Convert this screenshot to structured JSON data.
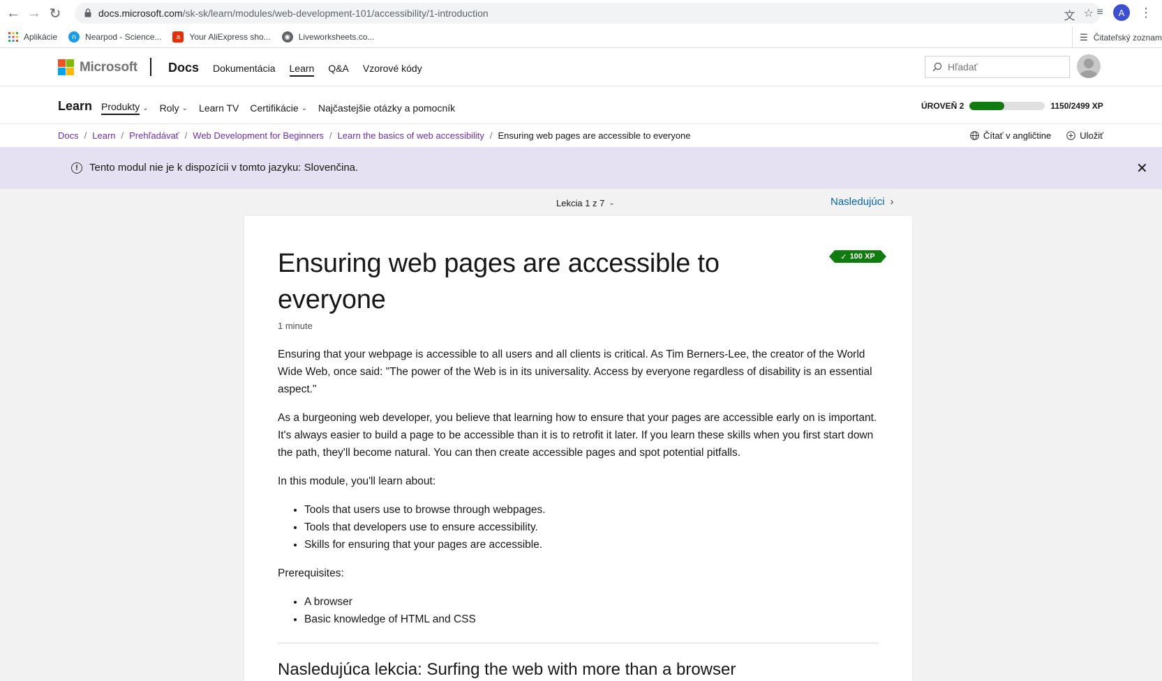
{
  "browser": {
    "url_host": "docs.microsoft.com",
    "url_path": "/sk-sk/learn/modules/web-development-101/accessibility/1-introduction",
    "profile_initial": "A",
    "bookmarks": [
      {
        "label": "Aplikácie",
        "icon": "apps-grid-icon"
      },
      {
        "label": "Nearpod - Science...",
        "icon": "nearpod-icon"
      },
      {
        "label": "Your AliExpress sho...",
        "icon": "aliexpress-icon"
      },
      {
        "label": "Liveworksheets.co...",
        "icon": "globe-icon"
      }
    ],
    "reading_list": "Čitateľský zoznam"
  },
  "header": {
    "brand": "Microsoft",
    "product": "Docs",
    "nav": [
      "Dokumentácia",
      "Learn",
      "Q&A",
      "Vzorové kódy"
    ],
    "search_placeholder": "Hľadať"
  },
  "learn_bar": {
    "title": "Learn",
    "nav": [
      "Produkty",
      "Roly",
      "Learn TV",
      "Certifikácie",
      "Najčastejšie otázky a pomocník"
    ],
    "level_label": "ÚROVEŇ 2",
    "xp_text": "1150/2499 XP",
    "xp_fraction": 0.46
  },
  "breadcrumb": {
    "items": [
      "Docs",
      "Learn",
      "Prehľadávať",
      "Web Development for Beginners",
      "Learn the basics of web accessibility"
    ],
    "current": "Ensuring web pages are accessible to everyone",
    "read_english": "Čítať v angličtine",
    "save": "Uložiť"
  },
  "alert": {
    "text": "Tento modul nie je k dispozícii v tomto jazyku: Slovenčina."
  },
  "lesson": {
    "position": "Lekcia 1 z 7",
    "next": "Nasledujúci",
    "xp_badge": "100 XP",
    "title": "Ensuring web pages are accessible to everyone",
    "duration": "1 minute",
    "p1": "Ensuring that your webpage is accessible to all users and all clients is critical. As Tim Berners-Lee, the creator of the World Wide Web, once said: \"The power of the Web is in its universality. Access by everyone regardless of disability is an essential aspect.\"",
    "p2": "As a burgeoning web developer, you believe that learning how to ensure that your pages are accessible early on is important. It's always easier to build a page to be accessible than it is to retrofit it later. If you learn these skills when you first start down the path, they'll become natural. You can then create accessible pages and spot potential pitfalls.",
    "p3": "In this module, you'll learn about:",
    "learn_items": [
      "Tools that users use to browse through webpages.",
      "Tools that developers use to ensure accessibility.",
      "Skills for ensuring that your pages are accessible."
    ],
    "prereq_label": "Prerequisites:",
    "prereq_items": [
      "A browser",
      "Basic knowledge of HTML and CSS"
    ],
    "next_heading": "Nasledujúca lekcia: Surfing the web with more than a browser"
  }
}
